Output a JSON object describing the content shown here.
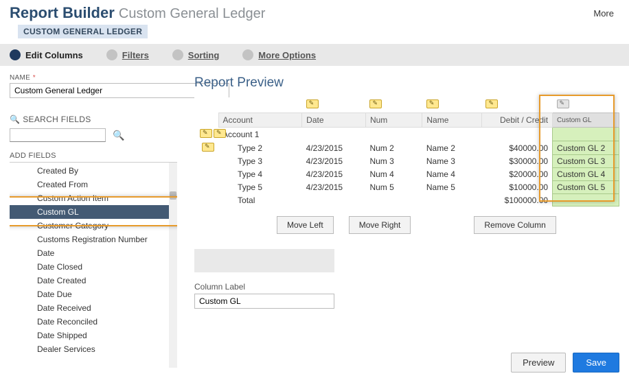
{
  "header": {
    "title_main": "Report Builder",
    "title_sub": "Custom General Ledger",
    "subtitle": "CUSTOM GENERAL LEDGER",
    "more": "More"
  },
  "steps": {
    "edit_columns": "Edit Columns",
    "filters": "Filters",
    "sorting": "Sorting",
    "more_options": "More Options"
  },
  "name": {
    "label": "NAME",
    "required": "*",
    "value": "Custom General Ledger"
  },
  "search": {
    "title": "SEARCH FIELDS",
    "value": ""
  },
  "add_fields": {
    "label": "ADD FIELDS",
    "items": [
      "Created By",
      "Created From",
      "Custom Action Item",
      "Custom GL",
      "Customer Category",
      "Customs Registration Number",
      "Date",
      "Date Closed",
      "Date Created",
      "Date Due",
      "Date Received",
      "Date Reconciled",
      "Date Shipped",
      "Dealer Services"
    ],
    "selected_index": 3
  },
  "preview": {
    "title": "Report Preview",
    "columns": {
      "account": "Account",
      "date": "Date",
      "num": "Num",
      "name": "Name",
      "debit_credit": "Debit / Credit",
      "custom_gl": "Custom GL"
    },
    "account_group": "Account 1",
    "rows": [
      {
        "type": "Type 2",
        "date": "4/23/2015",
        "num": "Num 2",
        "name": "Name 2",
        "amount": "$40000.00",
        "custom": "Custom GL 2"
      },
      {
        "type": "Type 3",
        "date": "4/23/2015",
        "num": "Num 3",
        "name": "Name 3",
        "amount": "$30000.00",
        "custom": "Custom GL 3"
      },
      {
        "type": "Type 4",
        "date": "4/23/2015",
        "num": "Num 4",
        "name": "Name 4",
        "amount": "$20000.00",
        "custom": "Custom GL 4"
      },
      {
        "type": "Type 5",
        "date": "4/23/2015",
        "num": "Num 5",
        "name": "Name 5",
        "amount": "$10000.00",
        "custom": "Custom GL 5"
      }
    ],
    "total_label": "Total",
    "total_amount": "$100000.00"
  },
  "buttons": {
    "move_left": "Move Left",
    "move_right": "Move Right",
    "remove_column": "Remove Column",
    "preview": "Preview",
    "save": "Save"
  },
  "column_label": {
    "label": "Column Label",
    "value": "Custom GL"
  }
}
